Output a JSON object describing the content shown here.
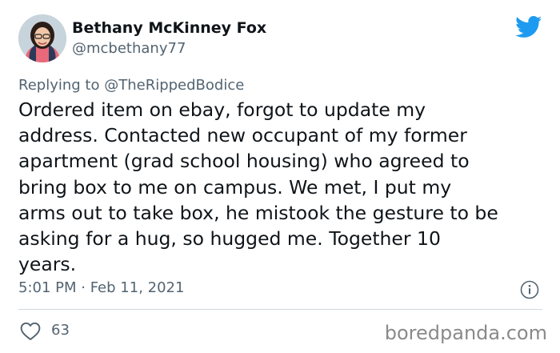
{
  "author": {
    "display_name": "Bethany McKinney Fox",
    "handle": "@mcbethany77",
    "avatar_icon": "profile-photo"
  },
  "reply": {
    "prefix": "Replying to",
    "mention": "@TheRippedBodice"
  },
  "tweet": {
    "lines": [
      "Ordered item on ebay, forgot to update my",
      "address. Contacted new occupant of my former",
      "apartment (grad school housing) who agreed to",
      "bring box to me on campus. We met, I put my",
      "arms out to take box, he mistook the gesture to be",
      "asking for a hug, so hugged me. Together 10",
      "years."
    ]
  },
  "meta": {
    "timestamp": "5:01 PM · Feb 11, 2021"
  },
  "engagement": {
    "likes": "63"
  },
  "watermark": "boredpanda.com",
  "colors": {
    "twitter_blue": "#1d9bf0",
    "secondary_text": "#536471",
    "primary_text": "#0f1419"
  },
  "icons": {
    "brand": "twitter-bird-icon",
    "info": "info-icon",
    "like": "heart-icon"
  }
}
